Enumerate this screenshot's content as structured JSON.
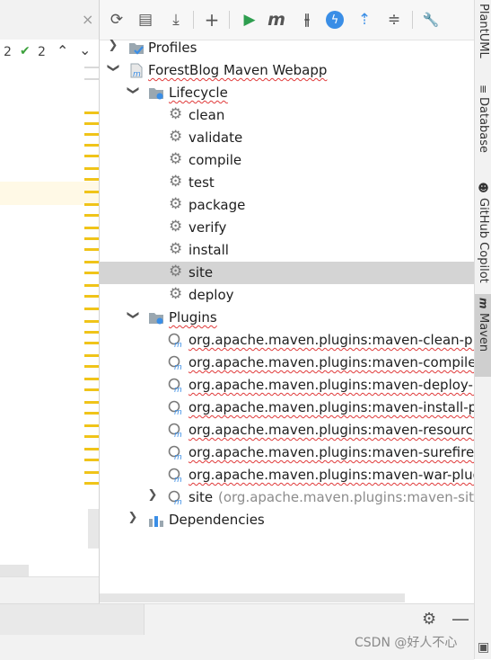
{
  "editor": {
    "close_glyph": "×",
    "inspections": {
      "warnings": "2",
      "ok": "2"
    }
  },
  "toolbar": {
    "buttons": [
      {
        "name": "reload-icon",
        "glyph": "⟳"
      },
      {
        "name": "add-folder-icon",
        "glyph": "▤"
      },
      {
        "name": "download-icon",
        "glyph": "⤓"
      },
      {
        "name": "plus-icon",
        "glyph": "+"
      },
      {
        "name": "run-icon",
        "glyph": "▶"
      },
      {
        "name": "maven-goal-icon",
        "glyph": "m"
      },
      {
        "name": "toggle-offline-icon",
        "glyph": "⫲"
      },
      {
        "name": "skip-tests-icon",
        "glyph": "ϟ"
      },
      {
        "name": "show-dependencies-icon",
        "glyph": "⇡"
      },
      {
        "name": "collapse-all-icon",
        "glyph": "≑"
      },
      {
        "name": "wrench-icon",
        "glyph": "🔧"
      }
    ]
  },
  "tree": {
    "profiles": "Profiles",
    "project": "ForestBlog Maven Webapp",
    "lifecycle": "Lifecycle",
    "lifecycle_items": [
      "clean",
      "validate",
      "compile",
      "test",
      "package",
      "verify",
      "install",
      "site",
      "deploy"
    ],
    "selected_lifecycle_item": "site",
    "plugins": "Plugins",
    "plugin_items": [
      "org.apache.maven.plugins:maven-clean-plu",
      "org.apache.maven.plugins:maven-compiler-",
      "org.apache.maven.plugins:maven-deploy-pl",
      "org.apache.maven.plugins:maven-install-plu",
      "org.apache.maven.plugins:maven-resources",
      "org.apache.maven.plugins:maven-surefire-p",
      "org.apache.maven.plugins:maven-war-plugi"
    ],
    "site_plugin": {
      "name": "site",
      "detail": "(org.apache.maven.plugins:maven-site-p"
    },
    "dependencies": "Dependencies"
  },
  "sidebar": {
    "tabs": [
      "PlantUML",
      "Database",
      "GitHub Copilot",
      "Maven"
    ],
    "active": "Maven"
  },
  "watermark": "CSDN @好人不心",
  "colors": {
    "selection": "#d4d4d4",
    "run_green": "#2e9e4f",
    "accent_blue": "#3a8ee6",
    "stripe_yellow": "#f0c419"
  }
}
